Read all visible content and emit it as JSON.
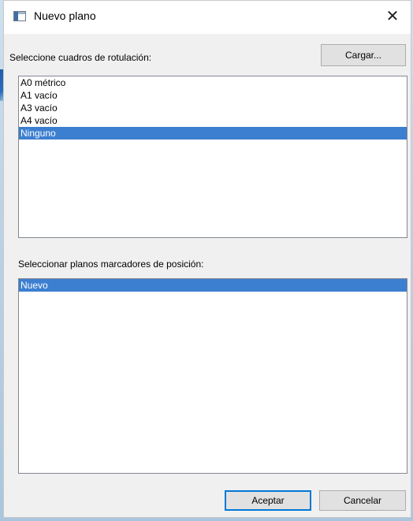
{
  "window": {
    "title": "Nuevo plano",
    "close_glyph": "✕"
  },
  "title_block": {
    "label": "Seleccione cuadros de rotulación:",
    "load_button": "Cargar...",
    "items": [
      {
        "label": "A0 métrico",
        "selected": false
      },
      {
        "label": "A1 vacío",
        "selected": false
      },
      {
        "label": "A3 vacío",
        "selected": false
      },
      {
        "label": "A4 vacío",
        "selected": false
      },
      {
        "label": "Ninguno",
        "selected": true
      }
    ]
  },
  "placeholder_sheets": {
    "label": "Seleccionar planos marcadores de posición:",
    "items": [
      {
        "label": "Nuevo",
        "selected": true
      }
    ]
  },
  "footer": {
    "accept_button": "Aceptar",
    "cancel_button": "Cancelar"
  },
  "colors": {
    "selection": "#3c7fd0",
    "dialog_bg": "#f0f0f0",
    "default_button_border": "#0078d7"
  },
  "icons": {
    "window_icon": "revit-sheet-icon",
    "close": "close-icon"
  }
}
